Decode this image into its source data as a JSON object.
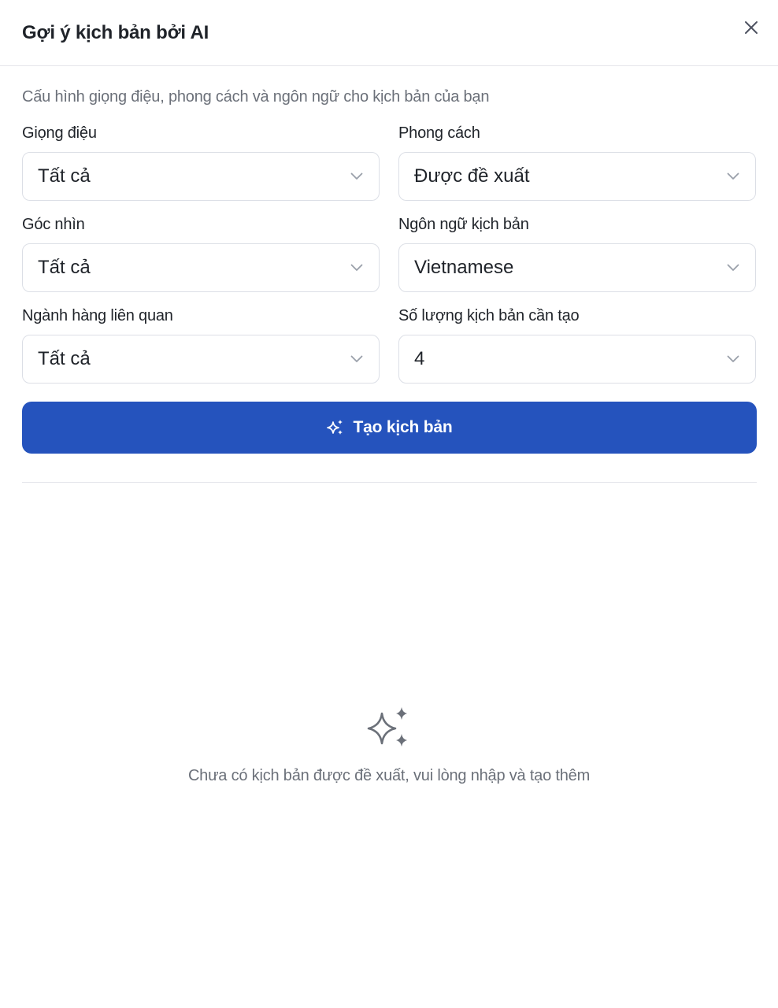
{
  "header": {
    "title": "Gợi ý kịch bản bởi AI",
    "close_icon": "close-icon"
  },
  "form": {
    "description": "Cấu hình giọng điệu, phong cách và ngôn ngữ cho kịch bản của bạn",
    "fields": {
      "tone": {
        "label": "Giọng điệu",
        "value": "Tất cả"
      },
      "style": {
        "label": "Phong cách",
        "value": "Được đề xuất"
      },
      "perspective": {
        "label": "Góc nhìn",
        "value": "Tất cả"
      },
      "language": {
        "label": "Ngôn ngữ kịch bản",
        "value": "Vietnamese"
      },
      "industry": {
        "label": "Ngành hàng liên quan",
        "value": "Tất cả"
      },
      "count": {
        "label": "Số lượng kịch bản cần tạo",
        "value": "4"
      }
    },
    "submit": {
      "label": "Tạo kịch bản",
      "icon": "sparkle-icon"
    }
  },
  "empty_state": {
    "icon": "sparkle-icon",
    "message": "Chưa có kịch bản được đề xuất, vui lòng nhập và tạo thêm"
  },
  "colors": {
    "primary": "#2553bd",
    "text": "#1f2329",
    "muted": "#6b7079",
    "border": "#dcdfe6"
  }
}
